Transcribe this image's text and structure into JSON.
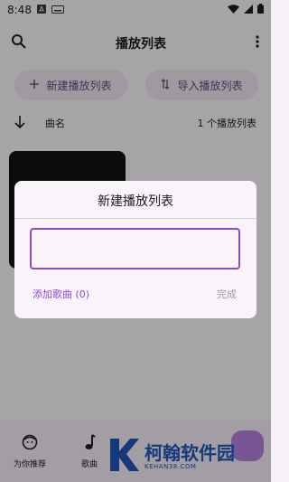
{
  "status_bar": {
    "time": "8:48"
  },
  "app_bar": {
    "title": "播放列表"
  },
  "actions": {
    "new_playlist": "新建播放列表",
    "import_playlist": "导入播放列表"
  },
  "list_header": {
    "column": "曲名",
    "count": "1 个播放列表"
  },
  "bottom_nav": {
    "items": [
      {
        "label": "为你推荐"
      },
      {
        "label": "歌曲"
      }
    ]
  },
  "watermark": {
    "brand": "柯翰软件园",
    "domain": "KEHAN38.COM"
  },
  "dialog": {
    "title": "新建播放列表",
    "input_value": "",
    "add_songs": "添加歌曲 (0)",
    "done": "完成"
  },
  "colors": {
    "accent": "#8e49d0",
    "chip_bg": "#e9e3ec",
    "chip_text": "#5b4b7d"
  }
}
